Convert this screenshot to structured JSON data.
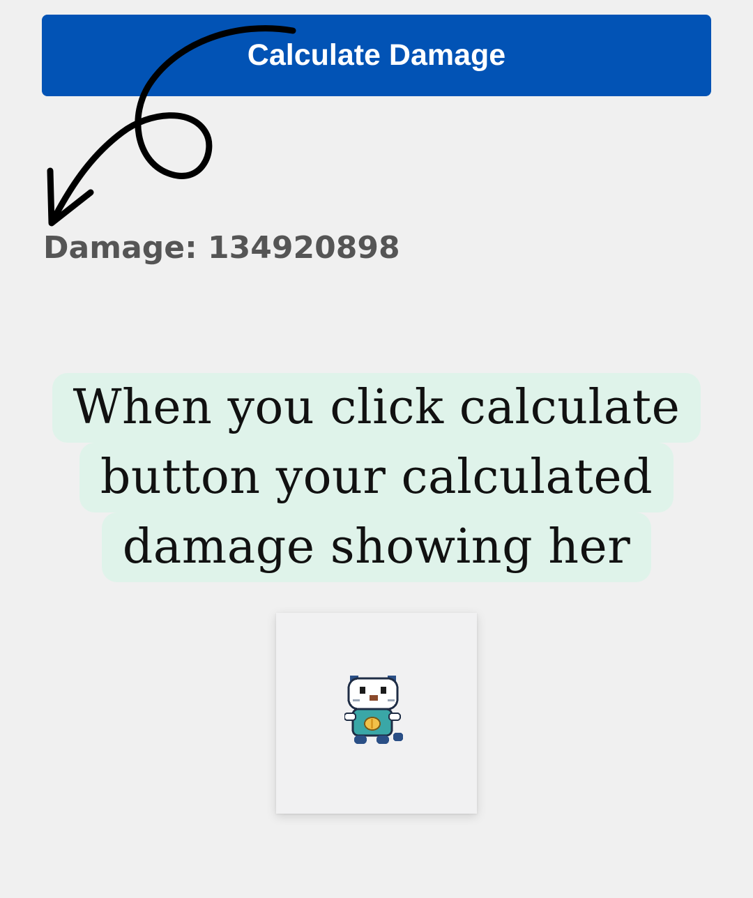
{
  "calculator": {
    "button_label": "Calculate Damage",
    "damage_label": "Damage:",
    "damage_value": "134920898"
  },
  "caption": {
    "lines": [
      "When you click calculate",
      "button your calculated",
      "damage showing her"
    ],
    "highlight_color": "#dff3ea"
  },
  "sprite": {
    "icon": "otter-pokemon-sprite"
  },
  "colors": {
    "button_bg": "#0253b5",
    "button_text": "#ffffff",
    "damage_text": "#555555",
    "page_bg": "#f0f0f0"
  }
}
